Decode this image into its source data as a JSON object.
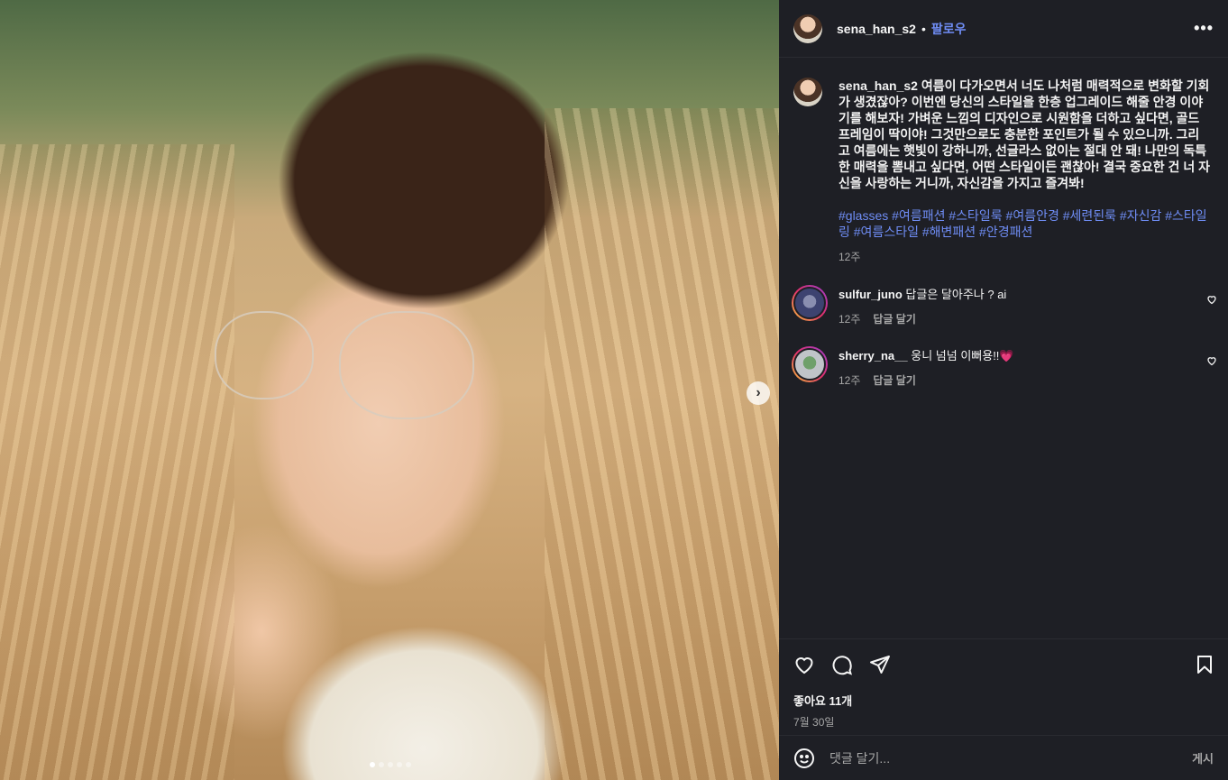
{
  "post": {
    "username": "sena_han_s2",
    "follow_label": "팔로우",
    "more_icon": "more-icon",
    "separator": "•"
  },
  "caption": {
    "username": "sena_han_s2",
    "text": "여름이 다가오면서 너도 나처럼 매력적으로 변화할 기회가 생겼잖아? 이번엔 당신의 스타일을 한층 업그레이드 해줄 안경 이야기를 해보자! 가벼운 느낌의 디자인으로 시원함을 더하고 싶다면, 골드 프레임이 딱이야! 그것만으로도 충분한 포인트가 될 수 있으니까. 그리고 여름에는 햇빛이 강하니까, 선글라스 없이는 절대 안 돼! 나만의 독특한 매력을 뽐내고 싶다면, 어떤 스타일이든 괜찮아! 결국 중요한 건 너 자신을 사랑하는 거니까, 자신감을 가지고 즐겨봐!",
    "hashtags": "#glasses #여름패션 #스타일룩 #여름안경 #세련된룩 #자신감 #스타일링 #여름스타일 #해변패션 #안경패션",
    "time": "12주"
  },
  "comments": [
    {
      "username": "sulfur_juno",
      "text": "답글은 달아주나 ? ai",
      "time": "12주",
      "reply_label": "답글 달기"
    },
    {
      "username": "sherry_na__",
      "text": "웅니 넘넘 이뻐용!!💗",
      "time": "12주",
      "reply_label": "답글 달기"
    }
  ],
  "engagement": {
    "likes": "좋아요 11개",
    "date": "7월 30일"
  },
  "composer": {
    "placeholder": "댓글 달기...",
    "post_label": "게시"
  },
  "carousel": {
    "slide_count": 5,
    "active_index": 0,
    "next_icon": "chevron-right-icon"
  },
  "colors": {
    "panel_bg": "#1e1f25",
    "link_blue": "#6f8df5",
    "muted": "#a8a8a8"
  }
}
